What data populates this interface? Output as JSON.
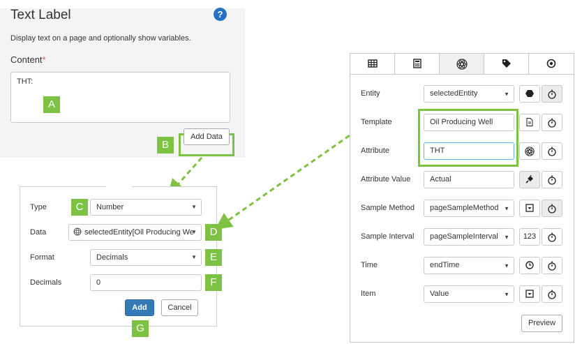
{
  "text_label": {
    "title": "Text Label",
    "help": "?",
    "description": "Display text on a page and optionally show variables.",
    "content_label": "Content",
    "required_mark": "*",
    "content_value": "THT:",
    "add_data_label": "Add Data"
  },
  "callouts": {
    "a": "A",
    "b": "B",
    "c": "C",
    "d": "D",
    "e": "E",
    "f": "F",
    "g": "G"
  },
  "add_data_form": {
    "type_label": "Type",
    "type_value": "Number",
    "data_label": "Data",
    "data_value": "selectedEntity[Oil Producing We",
    "format_label": "Format",
    "format_value": "Decimals",
    "decimals_label": "Decimals",
    "decimals_value": "0",
    "add_label": "Add",
    "cancel_label": "Cancel"
  },
  "properties": {
    "tabs": [
      {
        "icon": "table-icon"
      },
      {
        "icon": "calculator-icon"
      },
      {
        "icon": "atom-icon",
        "active": true
      },
      {
        "icon": "tag-icon"
      },
      {
        "icon": "target-icon"
      }
    ],
    "rows": {
      "entity": {
        "label": "Entity",
        "value": "selectedEntity"
      },
      "template": {
        "label": "Template",
        "value": "Oil Producing Well"
      },
      "attribute": {
        "label": "Attribute",
        "value": "THT"
      },
      "attribute_value": {
        "label": "Attribute Value",
        "value": "Actual"
      },
      "sample_method": {
        "label": "Sample Method",
        "value": "pageSampleMethod"
      },
      "sample_interval": {
        "label": "Sample Interval",
        "value": "pageSampleInterval",
        "button": "123"
      },
      "time": {
        "label": "Time",
        "value": "endTime"
      },
      "item": {
        "label": "Item",
        "value": "Value"
      }
    },
    "preview_label": "Preview"
  },
  "colors": {
    "highlight": "#7dc243",
    "primary": "#337ab7",
    "help": "#2672c2"
  }
}
